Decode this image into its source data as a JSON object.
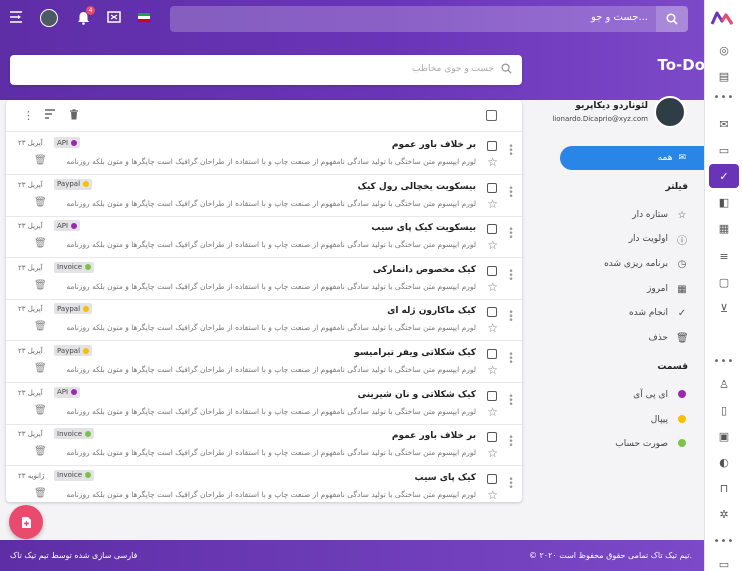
{
  "header": {
    "search_placeholder": "جست و جو...",
    "notification_count": "4",
    "app_title": "To-Do"
  },
  "task_search": {
    "placeholder": "جست و جوی مخاطب"
  },
  "user": {
    "name": "لئوناردو دیکاپریو",
    "email": "lionardo.Dicaprio@xyz.com"
  },
  "sidebar": {
    "all_label": "همه",
    "filter_heading": "فیلتر",
    "filters": [
      {
        "label": "ستاره دار",
        "icon": "star-icon"
      },
      {
        "label": "اولویت دار",
        "icon": "info-icon"
      },
      {
        "label": "برنامه ریزی شده",
        "icon": "clock-icon"
      },
      {
        "label": "امروز",
        "icon": "calendar-icon"
      },
      {
        "label": "انجام شده",
        "icon": "check-icon"
      },
      {
        "label": "حذف",
        "icon": "trash-icon"
      }
    ],
    "section_heading": "قسمت",
    "sections": [
      {
        "label": "ای پی آی",
        "color": "#9c27b0"
      },
      {
        "label": "پیپال",
        "color": "#f6c000"
      },
      {
        "label": "صورت حساب",
        "color": "#7cc24a"
      }
    ]
  },
  "tasks": [
    {
      "title": "بر خلاف باور عموم",
      "desc": "لورم ایپسوم متن ساختگی با تولید سادگی نامفهوم از صنعت چاپ و با استفاده از طراحان گرافیک است چاپگرها و متون بلکه روزنامه",
      "tag": "API",
      "tag_color": "#9c27b0",
      "date": "۲۳ آپریل"
    },
    {
      "title": "بیسکویت یخچالی رول کیک",
      "desc": "لورم ایپسوم متن ساختگی با تولید سادگی نامفهوم از صنعت چاپ و با استفاده از طراحان گرافیک است چاپگرها و متون بلکه روزنامه",
      "tag": "Paypal",
      "tag_color": "#f6c000",
      "date": "۲۳ آپریل"
    },
    {
      "title": "بیسکویت کیک پای سیب",
      "desc": "لورم ایپسوم متن ساختگی با تولید سادگی نامفهوم از صنعت چاپ و با استفاده از طراحان گرافیک است چاپگرها و متون بلکه روزنامه",
      "tag": "API",
      "tag_color": "#9c27b0",
      "date": "۲۳ آپریل"
    },
    {
      "title": "کیک مخصوص دانمارکی",
      "desc": "لورم ایپسوم متن ساختگی با تولید سادگی نامفهوم از صنعت چاپ و با استفاده از طراحان گرافیک است چاپگرها و متون بلکه روزنامه",
      "tag": "Invoice",
      "tag_color": "#7cc24a",
      "date": "۲۳ آپریل"
    },
    {
      "title": "کیک ماکارون ژله ای",
      "desc": "لورم ایپسوم متن ساختگی با تولید سادگی نامفهوم از صنعت چاپ و با استفاده از طراحان گرافیک است چاپگرها و متون بلکه روزنامه",
      "tag": "Paypal",
      "tag_color": "#f6c000",
      "date": "۲۳ آپریل"
    },
    {
      "title": "کیک شکلاتی ویفر تیرامیسو",
      "desc": "لورم ایپسوم متن ساختگی با تولید سادگی نامفهوم از صنعت چاپ و با استفاده از طراحان گرافیک است چاپگرها و متون بلکه روزنامه",
      "tag": "Paypal",
      "tag_color": "#f6c000",
      "date": "۲۳ آپریل"
    },
    {
      "title": "کیک شکلاتی و نان شیرینی",
      "desc": "لورم ایپسوم متن ساختگی با تولید سادگی نامفهوم از صنعت چاپ و با استفاده از طراحان گرافیک است چاپگرها و متون بلکه روزنامه",
      "tag": "API",
      "tag_color": "#9c27b0",
      "date": "۲۳ آپریل"
    },
    {
      "title": "بر خلاف باور عموم",
      "desc": "لورم ایپسوم متن ساختگی با تولید سادگی نامفهوم از صنعت چاپ و با استفاده از طراحان گرافیک است چاپگرها و متون بلکه روزنامه",
      "tag": "Invoice",
      "tag_color": "#7cc24a",
      "date": "۲۳ آپریل"
    },
    {
      "title": "کیک پای سیب",
      "desc": "لورم ایپسوم متن ساختگی با تولید سادگی نامفهوم از صنعت چاپ و با استفاده از طراحان گرافیک است چاپگرها و متون بلکه روزنامه",
      "tag": "Invoice",
      "tag_color": "#7cc24a",
      "date": "۲۳ ژانویه"
    }
  ],
  "footer": {
    "copyright": "© ۲۰۲۰ تیم تیک تاک تمامی حقوق محفوظ است.",
    "credit": "فارسی سازی شده توسط تیم تیک تاک"
  },
  "colors": {
    "primary": "#6a34b8",
    "accent": "#2a86e6",
    "fab": "#e94b6f"
  }
}
